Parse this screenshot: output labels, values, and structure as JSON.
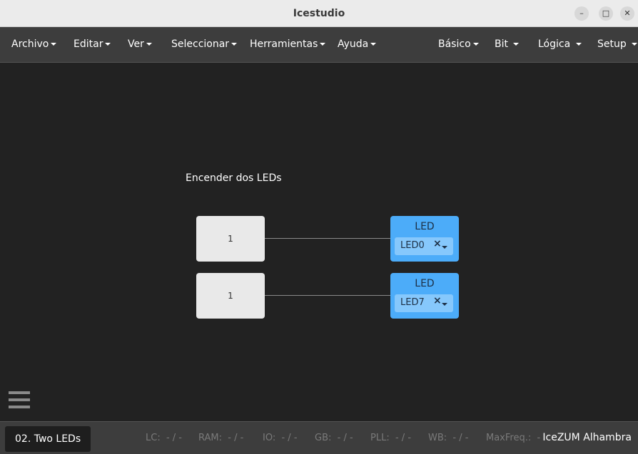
{
  "window": {
    "title": "Icestudio",
    "minimize_glyph": "–",
    "maximize_glyph": "□",
    "close_glyph": "✕"
  },
  "menu": {
    "left": [
      "Archivo",
      "Editar",
      "Ver",
      "Seleccionar",
      "Herramientas",
      "Ayuda"
    ],
    "right": [
      "Básico",
      "Bit",
      "Lógica",
      "Setup"
    ]
  },
  "canvas": {
    "comment": "Encender dos LEDs",
    "constants": [
      "1",
      "1"
    ],
    "leds": [
      {
        "title": "LED",
        "value": "LED0",
        "clear": "×"
      },
      {
        "title": "LED",
        "value": "LED7",
        "clear": "×"
      }
    ],
    "menu_icon": "hamburger-icon"
  },
  "footer": {
    "project": "02. Two LEDs",
    "stats": [
      {
        "label": "LC:",
        "value": "- / -"
      },
      {
        "label": "RAM:",
        "value": "- / -"
      },
      {
        "label": "IO:",
        "value": "- / -"
      },
      {
        "label": "GB:",
        "value": "- / -"
      },
      {
        "label": "PLL:",
        "value": "- / -"
      },
      {
        "label": "WB:",
        "value": "- / -"
      },
      {
        "label": "MaxFreq.:",
        "value": "-"
      }
    ],
    "board": "IceZUM Alhambra"
  },
  "colors": {
    "canvas_bg": "#222222",
    "menubar_bg": "#3d3d3d",
    "led_block": "#4cacf9",
    "constant_block": "#e9e9e9"
  }
}
